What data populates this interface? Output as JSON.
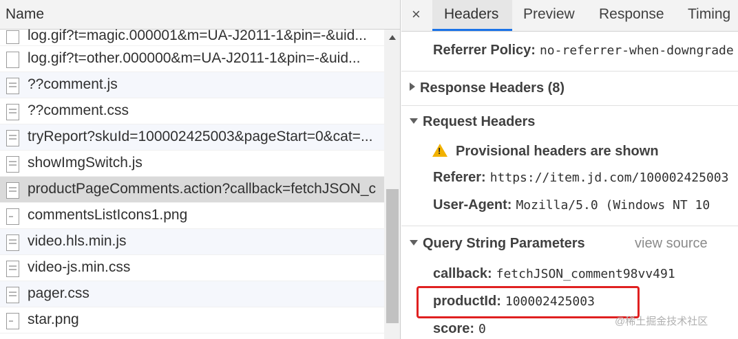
{
  "network_list": {
    "header": "Name",
    "rows": [
      {
        "label": "log.gif?t=magic.000001&m=UA-J2011-1&pin=-&uid...",
        "icon": "file-plain-icon"
      },
      {
        "label": "log.gif?t=other.000000&m=UA-J2011-1&pin=-&uid...",
        "icon": "file-plain-icon"
      },
      {
        "label": "??comment.js",
        "icon": "file-doc-icon"
      },
      {
        "label": "??comment.css",
        "icon": "file-doc-icon"
      },
      {
        "label": "tryReport?skuId=100002425003&pageStart=0&cat=...",
        "icon": "file-doc-icon"
      },
      {
        "label": "showImgSwitch.js",
        "icon": "file-doc-icon"
      },
      {
        "label": "productPageComments.action?callback=fetchJSON_c",
        "icon": "file-doc-icon",
        "selected": true
      },
      {
        "label": "commentsListIcons1.png",
        "icon": "image-file-icon"
      },
      {
        "label": "video.hls.min.js",
        "icon": "file-doc-icon"
      },
      {
        "label": "video-js.min.css",
        "icon": "file-doc-icon"
      },
      {
        "label": "pager.css",
        "icon": "file-doc-icon"
      },
      {
        "label": "star.png",
        "icon": "image-file-icon"
      }
    ]
  },
  "detail": {
    "close_glyph": "×",
    "tabs": [
      "Headers",
      "Preview",
      "Response",
      "Timing"
    ],
    "active_tab": "Headers",
    "referrer_policy": {
      "key": "Referrer Policy:",
      "value": "no-referrer-when-downgrade"
    },
    "response_headers": {
      "title": "Response Headers (8)",
      "expanded": false
    },
    "request_headers": {
      "title": "Request Headers",
      "expanded": true,
      "warning": "Provisional headers are shown",
      "referer": {
        "key": "Referer:",
        "value": "https://item.jd.com/100002425003"
      },
      "user_agent": {
        "key": "User-Agent:",
        "value": "Mozilla/5.0 (Windows NT 10"
      }
    },
    "query_string": {
      "title": "Query String Parameters",
      "view_source": "view source",
      "params": [
        {
          "key": "callback:",
          "value": "fetchJSON_comment98vv491"
        },
        {
          "key": "productId:",
          "value": "100002425003"
        },
        {
          "key": "score:",
          "value": "0"
        }
      ]
    }
  },
  "watermark": "@稀土掘金技术社区",
  "colors": {
    "accent": "#1a73e8",
    "highlight": "#e02020",
    "warning": "#f2b200"
  }
}
